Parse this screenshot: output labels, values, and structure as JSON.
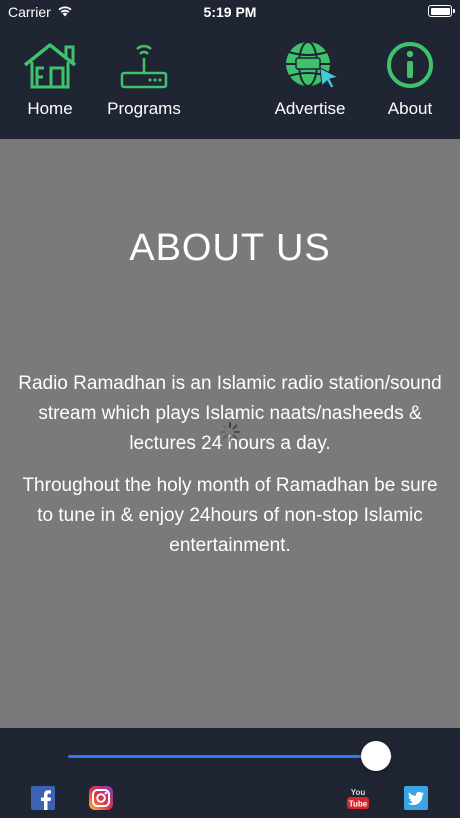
{
  "status": {
    "carrier": "Carrier",
    "time": "5:19 PM"
  },
  "nav": {
    "home": "Home",
    "programs": "Programs",
    "advertise": "Advertise",
    "about": "About"
  },
  "about": {
    "title": "ABOUT US",
    "paragraph1": "Radio Ramadhan is an Islamic radio station/sound stream which plays Islamic naats/nasheeds & lectures 24 hours a day.",
    "paragraph2": "Throughout the holy month of Ramadhan be sure to tune in & enjoy 24hours of non-stop Islamic entertainment."
  },
  "player": {
    "volume_fraction": 0.95
  },
  "icons": [
    "wifi-icon",
    "battery-icon",
    "home-icon",
    "router-icon",
    "globe-cursor-icon",
    "info-icon",
    "loading-spinner-icon",
    "facebook-icon",
    "instagram-icon",
    "youtube-icon",
    "twitter-icon"
  ],
  "colors": {
    "accent_green": "#3ec26b",
    "slider_blue": "#2c79f0",
    "background_dark": "#1f2533",
    "content_gray": "#7a7a7a"
  }
}
